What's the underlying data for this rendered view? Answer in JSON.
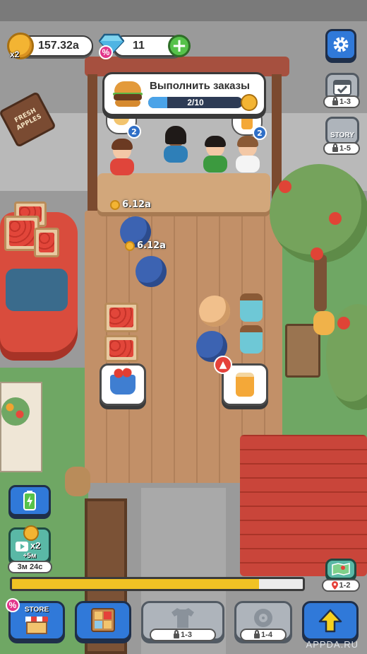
{
  "hud": {
    "coins_value": "157.32a",
    "coins_multiplier": "x2",
    "gems_value": "11",
    "gems_badge": "%"
  },
  "order": {
    "title": "Выполнить заказы",
    "progress_text": "2/10",
    "progress_fraction": 0.2
  },
  "side_right": {
    "calendar_lock": "1-3",
    "story_label": "STORY",
    "story_lock": "1-5"
  },
  "scene": {
    "price_1": "6.12a",
    "price_2": "6.12a",
    "thought_count_left": "2",
    "thought_count_right": "2",
    "sign_text": "FRESH APPLES"
  },
  "boosts": {
    "ad_multiplier": "x2",
    "ad_duration": "+5м",
    "timer": "3м 24с"
  },
  "progress": {
    "xp_fraction": 0.85,
    "map_lock": "1-2"
  },
  "bottom_bar": {
    "store_label": "STORE",
    "store_badge": "%",
    "locked_1": "1-3",
    "locked_2": "1-4"
  },
  "watermark": "APPDA.RU",
  "colors": {
    "accent_blue": "#3079d9",
    "coin_gold": "#f3b433",
    "bar_yellow": "#f1c224",
    "plus_green": "#56c24a"
  }
}
